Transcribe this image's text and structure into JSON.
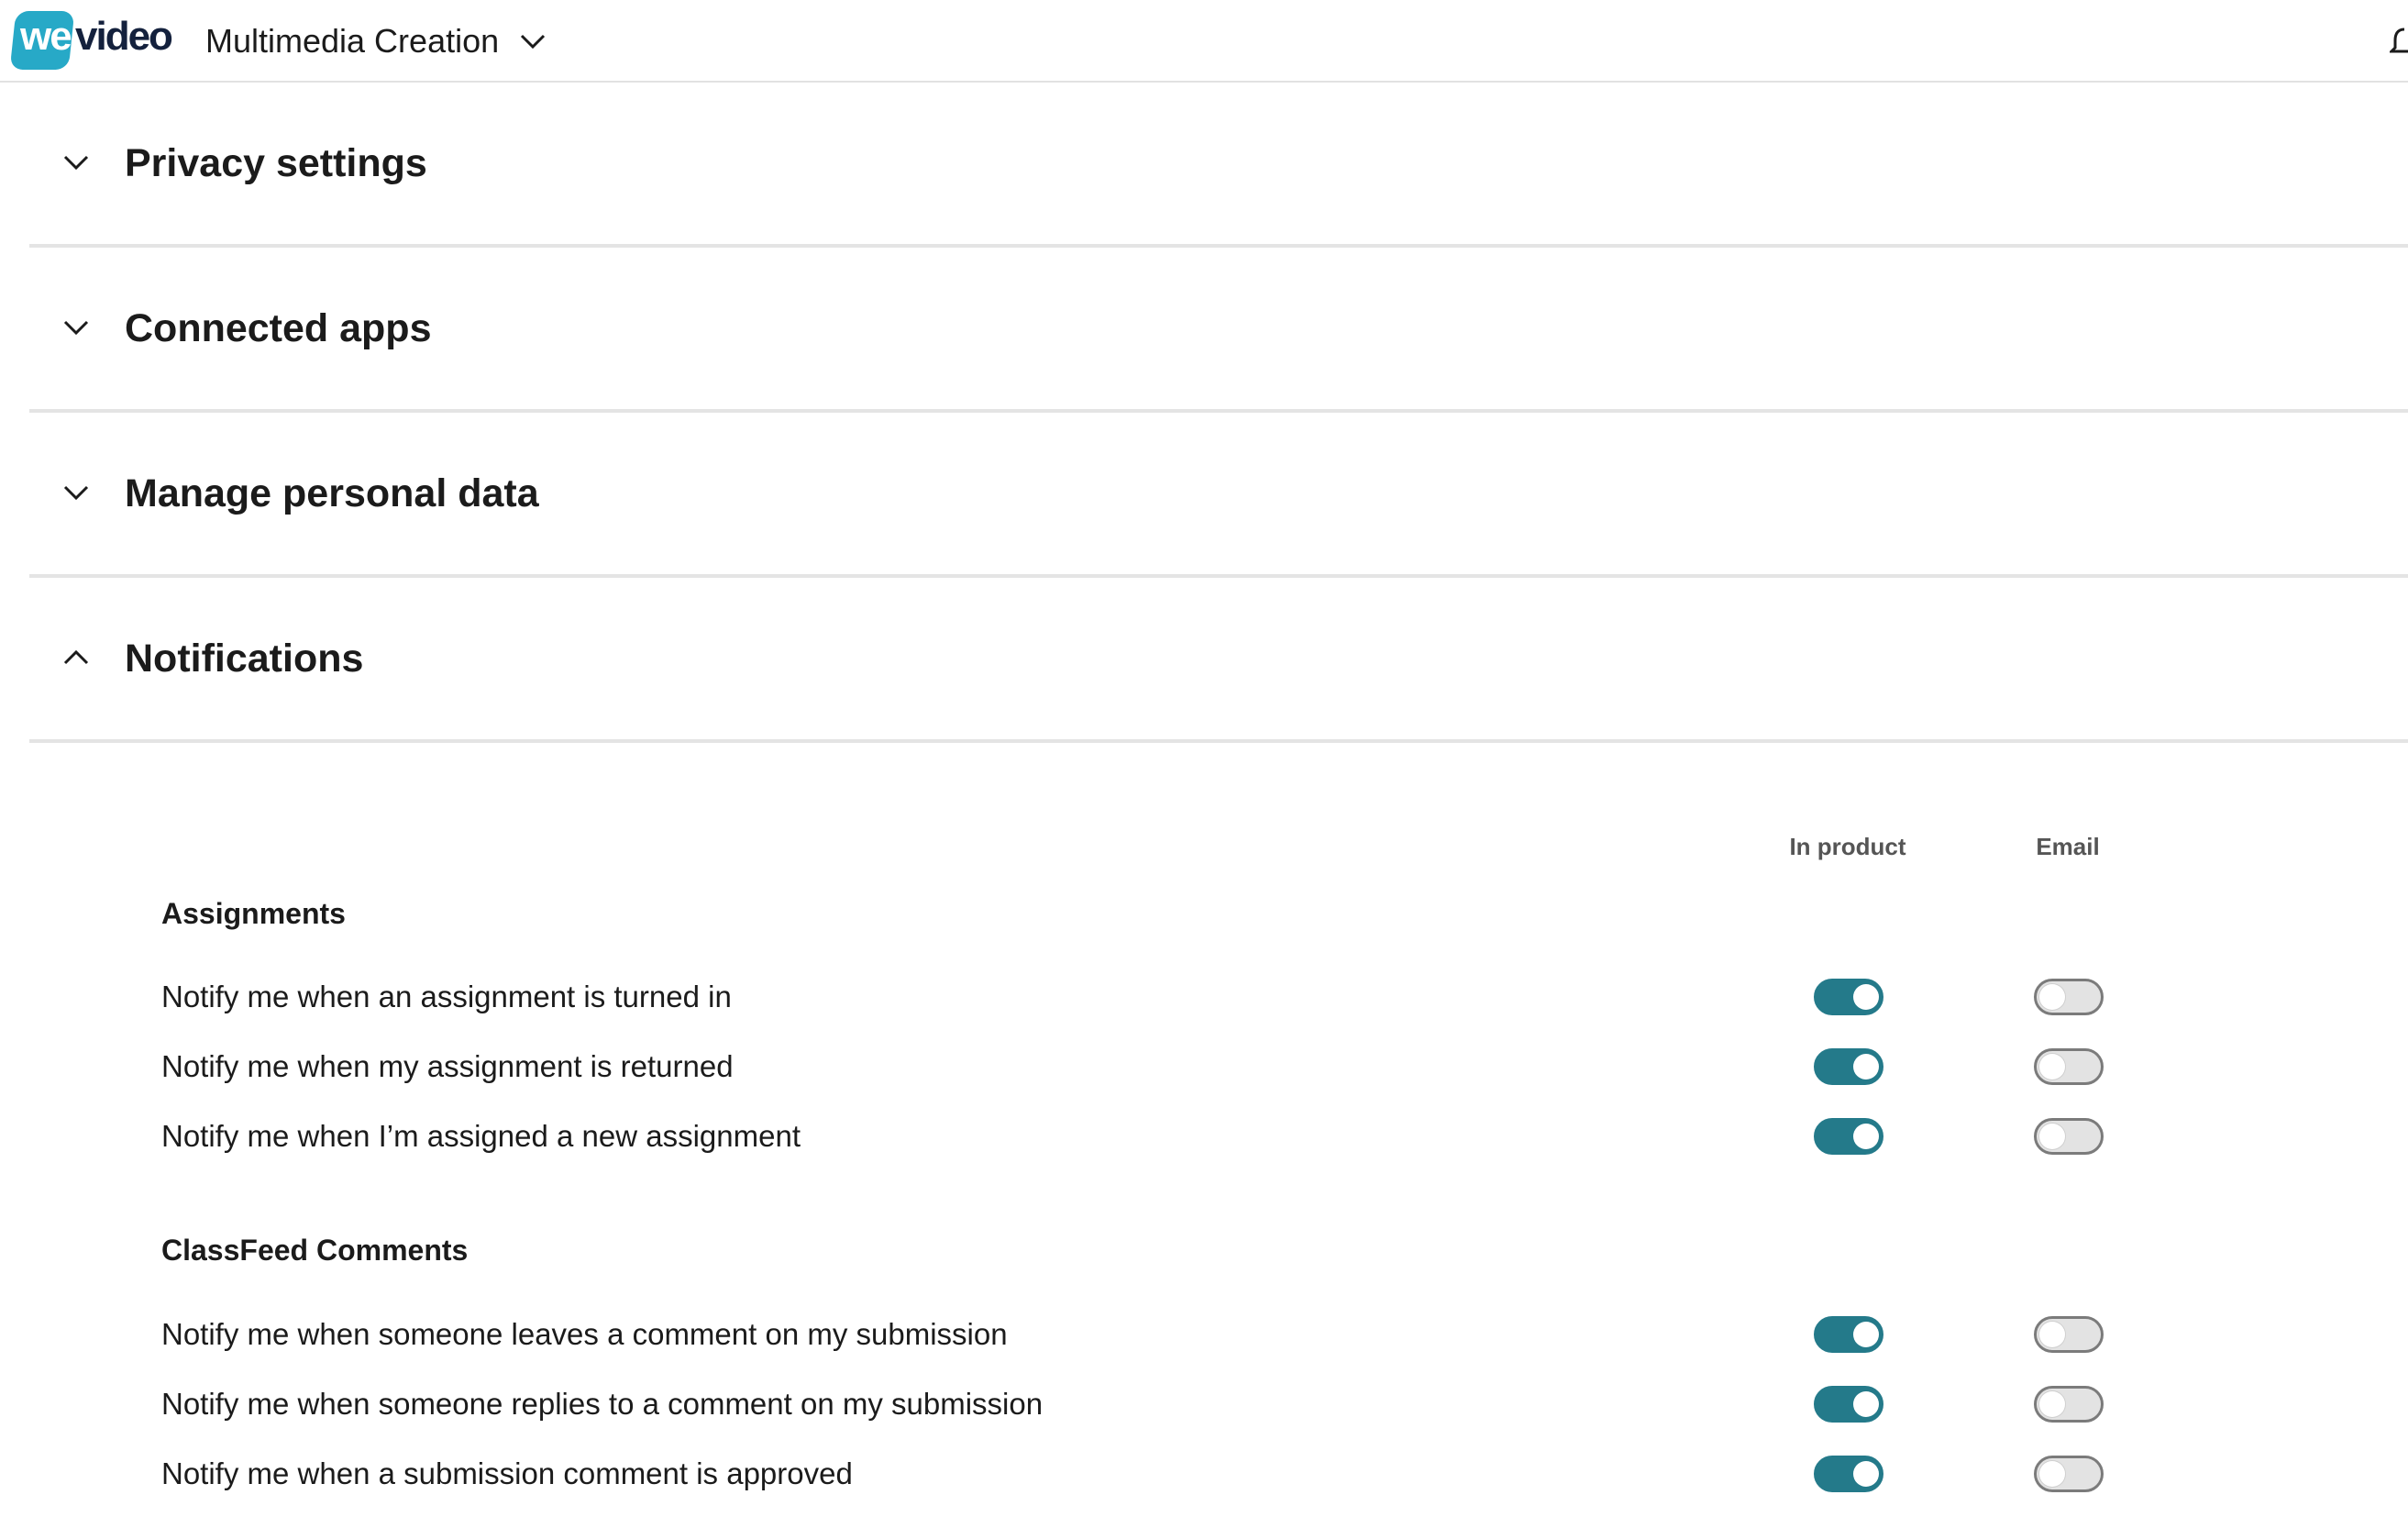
{
  "header": {
    "logo_prefix": "we",
    "logo_suffix": "video",
    "workspace_label": "Multimedia Creation",
    "icons": [
      "chevron-down-icon",
      "bell-icon"
    ]
  },
  "sections": [
    {
      "title": "Privacy settings",
      "expanded": false
    },
    {
      "title": "Connected apps",
      "expanded": false
    },
    {
      "title": "Manage personal data",
      "expanded": false
    },
    {
      "title": "Notifications",
      "expanded": true
    }
  ],
  "notifications": {
    "columns": {
      "in_product": "In product",
      "email": "Email"
    },
    "groups": [
      {
        "title": "Assignments",
        "rows": [
          {
            "label": "Notify me when an assignment is turned in",
            "in_product": true,
            "email": false
          },
          {
            "label": "Notify me when my assignment is returned",
            "in_product": true,
            "email": false
          },
          {
            "label": "Notify me when I’m assigned a new assignment",
            "in_product": true,
            "email": false
          }
        ]
      },
      {
        "title": "ClassFeed Comments",
        "rows": [
          {
            "label": "Notify me when someone leaves a comment on my submission",
            "in_product": true,
            "email": false
          },
          {
            "label": "Notify me when someone replies to a comment on my submission",
            "in_product": true,
            "email": false
          },
          {
            "label": "Notify me when a submission comment is approved",
            "in_product": true,
            "email": false
          }
        ]
      }
    ]
  },
  "colors": {
    "toggle_on": "#247a8a",
    "toggle_off": "#e3e3e3",
    "logo_tile": "#27a9c7",
    "divider": "#e4e4e4"
  }
}
